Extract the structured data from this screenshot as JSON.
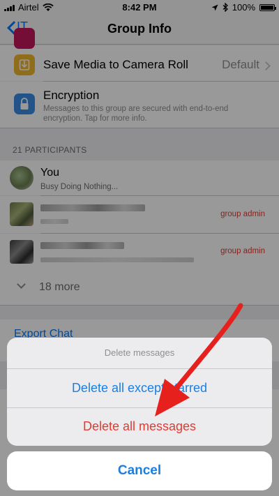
{
  "status_bar": {
    "carrier": "Airtel",
    "time": "8:42 PM",
    "battery": "100%",
    "battery_level": 1.0
  },
  "nav": {
    "back_label": "IT",
    "title": "Group Info"
  },
  "settings": {
    "save_media": {
      "label": "Save Media to Camera Roll",
      "value": "Default"
    },
    "encryption": {
      "title": "Encryption",
      "subtitle": "Messages to this group are secured with end-to-end encryption. Tap for more info."
    }
  },
  "participants": {
    "header": "21 PARTICIPANTS",
    "you": {
      "name": "You",
      "status": "Busy Doing Nothing..."
    },
    "admin_label": "group admin",
    "more_label": "18 more"
  },
  "export_chat_label": "Export Chat",
  "action_sheet": {
    "title": "Delete messages",
    "option_except_starred": "Delete all except starred",
    "option_all": "Delete all messages",
    "cancel": "Cancel"
  },
  "colors": {
    "ios_blue": "#1c7fe0",
    "destructive_red": "#e23a30",
    "arrow_red": "#e6201c",
    "save_media_icon": "#f1b62e",
    "encryption_icon": "#3a8de4"
  }
}
